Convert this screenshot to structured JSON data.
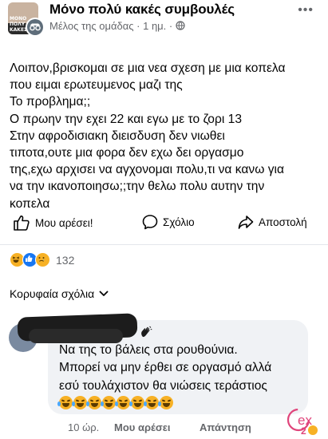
{
  "post": {
    "group_name": "Μόνο πολύ κακές συμβουλές",
    "author_role": "Μέλος της ομάδας",
    "time": "1 ημ.",
    "dot_separator": "·",
    "group_avatar_text": "ΜΟΝΟ ΠΟΛΥ ΚΑΚΕΣ",
    "body_lines": [
      "Λοιπον,βρισκομαι σε μια νεα σχεση με μια κοπελα",
      "που ειμαι ερωτευμενος μαζι της",
      "Το προβλημα;;",
      "Ο πρωην την εχει 22 και εγω με το ζορι 13",
      "Στην αφροδισιακη διεισδυση δεν νιωθει",
      "τιποτα,ουτε μια φορα δεν εχω δει οργασμο",
      "της,εχω αρχισει να αγχονομαι πολυ,τι να κανω για",
      "να την ικανοποιησω;;την θελω πολυ αυτην την",
      "κοπελα"
    ]
  },
  "actions": {
    "like_label": "Μου αρέσει!",
    "comment_label": "Σχόλιο",
    "share_label": "Αποστολή"
  },
  "reactions": {
    "count": "132",
    "types": [
      "haha",
      "like",
      "sad"
    ]
  },
  "comments_section": {
    "sort_label": "Κορυφαία σχόλια"
  },
  "comment": {
    "lines": [
      "Να της το βάλεις στα ρουθούνια.",
      "Μπορεί να μην έρθει σε οργασμό αλλά",
      "εσύ τουλάχιστον θα νιώσεις τεράστιος"
    ],
    "emoji_count": 8,
    "emoji_type": "crying-laughing",
    "time": "10 ώρ.",
    "like_label": "Μου αρέσει",
    "reply_label": "Απάντηση"
  },
  "colors": {
    "like_blue": "#1877f2",
    "haha_yellow": "#f7b125",
    "secondary_text": "#65676b",
    "bubble_bg": "#f0f2f5",
    "watermark_pink": "#e0457b"
  }
}
